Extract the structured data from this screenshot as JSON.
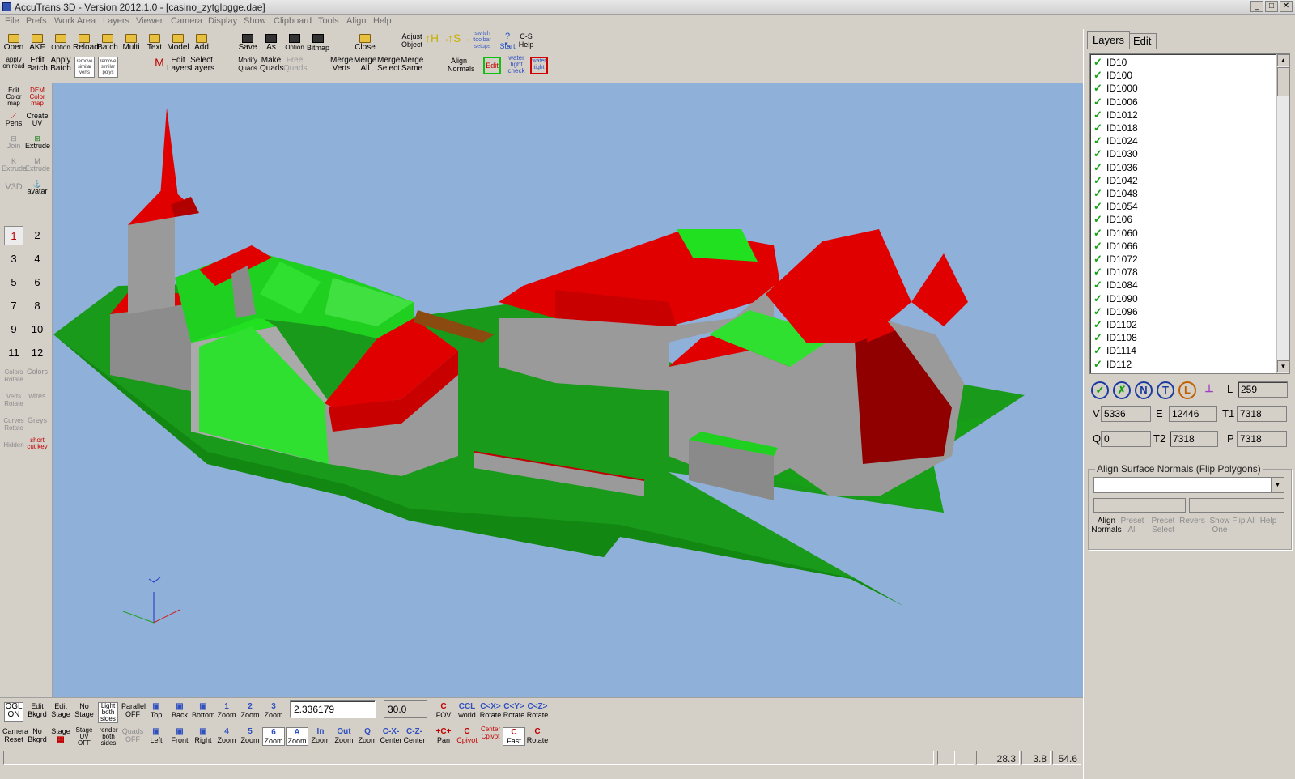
{
  "window": {
    "title": "AccuTrans 3D - Version 2012.1.0 - [casino_zytglogge.dae]",
    "buttons": [
      "_",
      "□",
      "✕"
    ]
  },
  "menu": [
    "File",
    "Prefs",
    "Work Area",
    "Layers",
    "Viewer",
    "Camera",
    "Display",
    "Show",
    "Clipboard",
    "Tools",
    "Align",
    "Help"
  ],
  "toolbar": {
    "row1": [
      {
        "id": "open",
        "label": "Open"
      },
      {
        "id": "akf",
        "label": "AKF"
      },
      {
        "id": "option",
        "label": "Option"
      },
      {
        "id": "reload",
        "label": "Reload"
      },
      {
        "id": "batch",
        "label": "Batch"
      },
      {
        "id": "multi",
        "label": "Multi"
      },
      {
        "id": "text",
        "label": "Text"
      },
      {
        "id": "model",
        "label": "Model"
      },
      {
        "id": "add",
        "label": "Add"
      },
      {
        "id": "save",
        "label": "Save"
      },
      {
        "id": "save-as",
        "label": "As"
      },
      {
        "id": "save-option",
        "label": "Option"
      },
      {
        "id": "bitmap",
        "label": "Bitmap"
      },
      {
        "id": "close",
        "label": "Close"
      },
      {
        "id": "adjust-object",
        "label": "Adjust Object"
      },
      {
        "id": "switch-toolbar",
        "label": "switch toolbar setups"
      },
      {
        "id": "start",
        "label": "Start"
      },
      {
        "id": "cs-help",
        "label": "C-S Help"
      }
    ],
    "row2": [
      {
        "id": "apply-on-read",
        "label": "apply on read"
      },
      {
        "id": "edit-batch",
        "label": "Edit Batch"
      },
      {
        "id": "apply-batch",
        "label": "Apply Batch"
      },
      {
        "id": "remove-similar-verts",
        "label": "remove similar verts"
      },
      {
        "id": "remove-similar-polys",
        "label": "remove similar polys"
      },
      {
        "id": "m-icon",
        "label": "M"
      },
      {
        "id": "edit-layers",
        "label": "Edit Layers"
      },
      {
        "id": "select-layers",
        "label": "Select Layers"
      },
      {
        "id": "modify-quads",
        "label": "Modify Quads"
      },
      {
        "id": "make-quads",
        "label": "Make Quads"
      },
      {
        "id": "free-quads",
        "label": "Free Quads"
      },
      {
        "id": "merge-verts",
        "label": "Merge Verts"
      },
      {
        "id": "merge-all",
        "label": "Merge All"
      },
      {
        "id": "merge-select",
        "label": "Merge Select"
      },
      {
        "id": "merge-same",
        "label": "Merge Same"
      },
      {
        "id": "align-normals",
        "label": "Align Normals"
      },
      {
        "id": "edit",
        "label": "Edit"
      },
      {
        "id": "water-tight-check",
        "label": "water tight check"
      },
      {
        "id": "water-tight",
        "label": "water tight"
      }
    ]
  },
  "lefttools": [
    {
      "id": "edit-color-map",
      "label": "Edit Color map"
    },
    {
      "id": "dem-color-map",
      "label": "DEM Color map"
    },
    {
      "id": "pens",
      "label": "Pens"
    },
    {
      "id": "create-uv",
      "label": "Create UV"
    },
    {
      "id": "join",
      "label": "Join"
    },
    {
      "id": "extrude",
      "label": "Extrude"
    },
    {
      "id": "k-extrude",
      "label": "K Extrude"
    },
    {
      "id": "m-extrude",
      "label": "M Extrude"
    },
    {
      "id": "v3d",
      "label": "V3D"
    },
    {
      "id": "avatar",
      "label": "avatar"
    }
  ],
  "numbers": [
    "1",
    "2",
    "3",
    "4",
    "5",
    "6",
    "7",
    "8",
    "9",
    "10",
    "11",
    "12"
  ],
  "lefttools2": [
    {
      "id": "colors-rotate",
      "label": "Colors Rotate"
    },
    {
      "id": "colors",
      "label": "Colors"
    },
    {
      "id": "verts-rotate",
      "label": "Verts Rotate"
    },
    {
      "id": "wires",
      "label": "wires"
    },
    {
      "id": "curves-rotate",
      "label": "Curves Rotate"
    },
    {
      "id": "greys",
      "label": "Greys"
    },
    {
      "id": "hidden",
      "label": "Hidden"
    },
    {
      "id": "short-cut-key",
      "label": "short cut key"
    }
  ],
  "bottom": {
    "row1": [
      {
        "id": "ogl-on",
        "label": "OGL ON"
      },
      {
        "id": "edit-bkgrd",
        "label": "Edit Bkgrd"
      },
      {
        "id": "edit-stage",
        "label": "Edit Stage"
      },
      {
        "id": "no-stage",
        "label": "No Stage"
      },
      {
        "id": "light-both-sides",
        "label": "Light both sides"
      },
      {
        "id": "parallel-off",
        "label": "Parallel OFF"
      },
      {
        "id": "top",
        "label": "Top"
      },
      {
        "id": "back",
        "label": "Back"
      },
      {
        "id": "bottom",
        "label": "Bottom"
      },
      {
        "id": "zoom-1",
        "label": "Zoom",
        "ic": "1"
      },
      {
        "id": "zoom-2",
        "label": "Zoom",
        "ic": "2"
      },
      {
        "id": "zoom-3",
        "label": "Zoom",
        "ic": "3"
      }
    ],
    "row1b": [
      {
        "id": "fov",
        "label": "FOV",
        "ic": "C"
      },
      {
        "id": "world",
        "label": "world",
        "ic": "CCL"
      },
      {
        "id": "rotate-x",
        "label": "Rotate",
        "ic": "C<X>"
      },
      {
        "id": "rotate-y",
        "label": "Rotate",
        "ic": "C<Y>"
      },
      {
        "id": "rotate-z",
        "label": "Rotate",
        "ic": "C<Z>"
      }
    ],
    "row2": [
      {
        "id": "camera-reset",
        "label": "Camera Reset"
      },
      {
        "id": "no-bkgrd",
        "label": "No Bkgrd"
      },
      {
        "id": "stage",
        "label": "Stage"
      },
      {
        "id": "stage-uv-off",
        "label": "Stage UV OFF"
      },
      {
        "id": "render-both-sides",
        "label": "render both sides"
      },
      {
        "id": "quads-off",
        "label": "Quads OFF"
      },
      {
        "id": "left",
        "label": "Left"
      },
      {
        "id": "front",
        "label": "Front"
      },
      {
        "id": "right",
        "label": "Right"
      },
      {
        "id": "zoom-4",
        "label": "Zoom",
        "ic": "4"
      },
      {
        "id": "zoom-5",
        "label": "Zoom",
        "ic": "5"
      },
      {
        "id": "zoom-6",
        "label": "Zoom",
        "ic": "6"
      },
      {
        "id": "zoom-a",
        "label": "Zoom",
        "ic": "A"
      },
      {
        "id": "zoom-in",
        "label": "Zoom",
        "ic": "In"
      },
      {
        "id": "zoom-out",
        "label": "Zoom",
        "ic": "Out"
      },
      {
        "id": "zoom-q",
        "label": "Zoom",
        "ic": "Q"
      },
      {
        "id": "center-x",
        "label": "Center",
        "ic": "C-X-"
      },
      {
        "id": "center-z",
        "label": "Center",
        "ic": "C-Z-"
      },
      {
        "id": "pan",
        "label": "Pan",
        "ic": "+C+"
      },
      {
        "id": "c-pivot",
        "label": "Cpivot",
        "ic": "C"
      },
      {
        "id": "center-c-pivot",
        "label": "Center Cpivot",
        "ic": ""
      },
      {
        "id": "fast",
        "label": "Fast",
        "ic": "C"
      },
      {
        "id": "rotate",
        "label": "Rotate",
        "ic": "C"
      }
    ],
    "zoom_value": "2.336179",
    "fov_value": "30.0"
  },
  "status": {
    "a": "28.3",
    "b": "3.8",
    "c": "54.6"
  },
  "right": {
    "tabs": [
      "Layers",
      "Edit"
    ],
    "layers": [
      "ID10",
      "ID100",
      "ID1000",
      "ID1006",
      "ID1012",
      "ID1018",
      "ID1024",
      "ID1030",
      "ID1036",
      "ID1042",
      "ID1048",
      "ID1054",
      "ID106",
      "ID1060",
      "ID1066",
      "ID1072",
      "ID1078",
      "ID1084",
      "ID1090",
      "ID1096",
      "ID1102",
      "ID1108",
      "ID1114",
      "ID112"
    ],
    "round_buttons": [
      "✓",
      "✗",
      "N",
      "T",
      "L",
      "⊥"
    ],
    "fields": {
      "L": "259",
      "V": "5336",
      "E": "12446",
      "T1": "7318",
      "Q": "0",
      "T2": "7318",
      "P": "7318"
    },
    "group_title": "Align Surface Normals (Flip Polygons)",
    "group_buttons": [
      {
        "id": "align-normals",
        "label": "Align Normals",
        "enabled": true
      },
      {
        "id": "preset-all",
        "label": "Preset All",
        "enabled": false
      },
      {
        "id": "preset-select",
        "label": "Preset Select",
        "enabled": false
      },
      {
        "id": "revers",
        "label": "Revers",
        "enabled": false
      },
      {
        "id": "show-one",
        "label": "Show One",
        "enabled": false
      },
      {
        "id": "flip-all",
        "label": "Flip All",
        "enabled": false
      },
      {
        "id": "help",
        "label": "Help",
        "enabled": false
      }
    ]
  }
}
